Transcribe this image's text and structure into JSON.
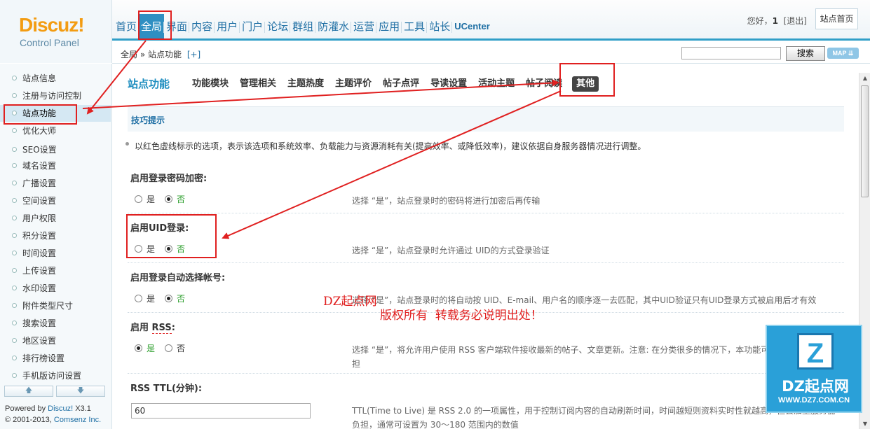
{
  "header": {
    "logo_brand": "Discuz!",
    "logo_sub": "Control Panel",
    "nav": [
      "首页",
      "全局",
      "界面",
      "内容",
      "用户",
      "门户",
      "论坛",
      "群组",
      "防灌水",
      "运营",
      "应用",
      "工具",
      "站长",
      "UCenter"
    ],
    "user_greeting": "您好，",
    "user_name": "1",
    "logout_label": "[退出]",
    "home_button": "站点首页"
  },
  "subbar": {
    "breadcrumb": "全局 » 站点功能",
    "breadcrumb_add": "[+]",
    "search_value": "",
    "search_button": "搜索",
    "map_button": "MAP ⇊"
  },
  "sidebar": {
    "items": [
      "站点信息",
      "注册与访问控制",
      "站点功能",
      "优化大师",
      "SEO设置",
      "域名设置",
      "广播设置",
      "空间设置",
      "用户权限",
      "积分设置",
      "时间设置",
      "上传设置",
      "水印设置",
      "附件类型尺寸",
      "搜索设置",
      "地区设置",
      "排行榜设置",
      "手机版访问设置"
    ],
    "active_index": 2,
    "scroll_up": "🡅",
    "scroll_down": "🡇",
    "powered_prefix": "Powered by ",
    "powered_name": "Discuz!",
    "powered_version": " X3.1",
    "copyright_prefix": "© 2001-2013, ",
    "copyright_name": "Comsenz Inc."
  },
  "main": {
    "page_title": "站点功能",
    "tabs": [
      "功能模块",
      "管理相关",
      "主题热度",
      "主题评价",
      "帖子点评",
      "导读设置",
      "活动主题",
      "帖子阅读",
      "其他"
    ],
    "active_tab_index": 8,
    "tips_title": "技巧提示",
    "tips_text": "以红色虚线标示的选项，表示该选项和系统效率、负载能力与资源消耗有关(提高效率、或降低效率)，建议依据自身服务器情况进行调整。",
    "settings": [
      {
        "label": "启用登录密码加密:",
        "yes": "是",
        "no": "否",
        "value": "no",
        "desc": "选择 “是”，站点登录时的密码将进行加密后再传输"
      },
      {
        "label": "启用UID登录:",
        "yes": "是",
        "no": "否",
        "value": "no",
        "desc": "选择 “是”，站点登录时允许通过 UID的方式登录验证"
      },
      {
        "label": "启用登录自动选择帐号:",
        "yes": "是",
        "no": "否",
        "value": "no",
        "desc": "选择 “是”，站点登录时的将自动按 UID、E-mail、用户名的顺序逐一去匹配，其中UID验证只有UID登录方式被启用后才有效"
      },
      {
        "label_prefix": "启用 ",
        "label_dashed": "RSS",
        "label_suffix": ":",
        "yes": "是",
        "no": "否",
        "value": "yes",
        "desc": "选择 “是”，将允许用户使用 RSS 客户端软件接收最新的帖子、文章更新。注意: 在分类很多的情况下，本功能可能会加重服务器负担"
      },
      {
        "label": "RSS TTL(分钟):",
        "input_value": "60",
        "desc": "TTL(Time to Live) 是 RSS 2.0 的一项属性，用于控制订阅内容的自动刷新时间，时间越短则资料实时性就越高，但会加重服务器负担，通常可设置为 30～180 范围内的数值"
      }
    ]
  },
  "annotations": {
    "watermark_line1": "DZ起点网",
    "watermark_line2": "版权所有  转载务必说明出处！",
    "logo_letter": "Z",
    "logo_name": "DZ起点网",
    "logo_url": "WWW.DZ7.COM.CN",
    "color": "#e02020"
  }
}
